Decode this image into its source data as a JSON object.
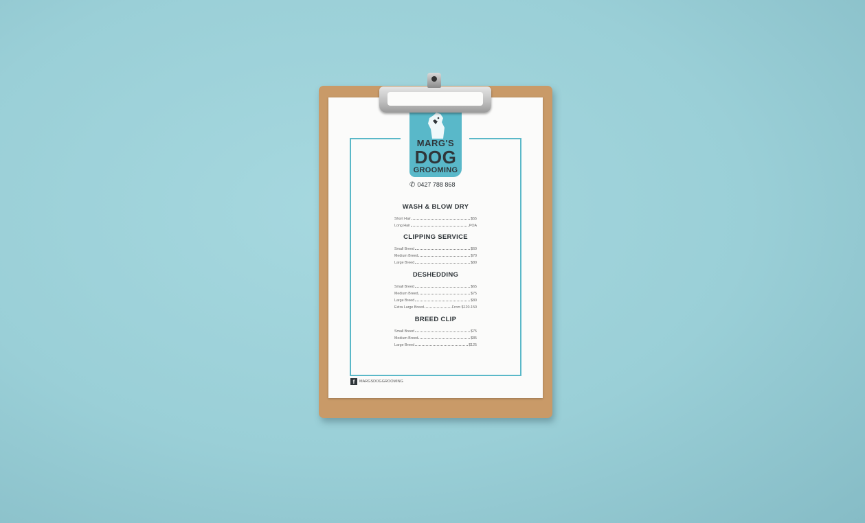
{
  "brand": {
    "line1": "MARG'S",
    "line2": "DOG",
    "line3": "GROOMING",
    "accent_color": "#5ab8c8"
  },
  "phone": {
    "icon": "phone-icon",
    "number": "0427 788 868"
  },
  "sections": [
    {
      "title": "WASH & BLOW DRY",
      "items": [
        {
          "name": "Short Hair",
          "price": "$55"
        },
        {
          "name": "Long Hair",
          "price": "POA"
        }
      ]
    },
    {
      "title": "CLIPPING SERVICE",
      "items": [
        {
          "name": "Small Breed",
          "price": "$60"
        },
        {
          "name": "Medium Breed",
          "price": "$70"
        },
        {
          "name": "Large Breed",
          "price": "$80"
        }
      ]
    },
    {
      "title": "DESHEDDING",
      "items": [
        {
          "name": "Small Breed",
          "price": "$65"
        },
        {
          "name": "Medium Breed",
          "price": "$75"
        },
        {
          "name": "Large Breed",
          "price": "$80"
        },
        {
          "name": "Extra Large Breed",
          "price": "From $120-150"
        }
      ]
    },
    {
      "title": "BREED CLIP",
      "items": [
        {
          "name": "Small Breed",
          "price": "$75"
        },
        {
          "name": "Medium Breed",
          "price": "$85"
        },
        {
          "name": "Large Breed",
          "price": "$125"
        }
      ]
    }
  ],
  "social": {
    "icon": "facebook-icon",
    "handle": "MARGSDOGGROOMING"
  }
}
